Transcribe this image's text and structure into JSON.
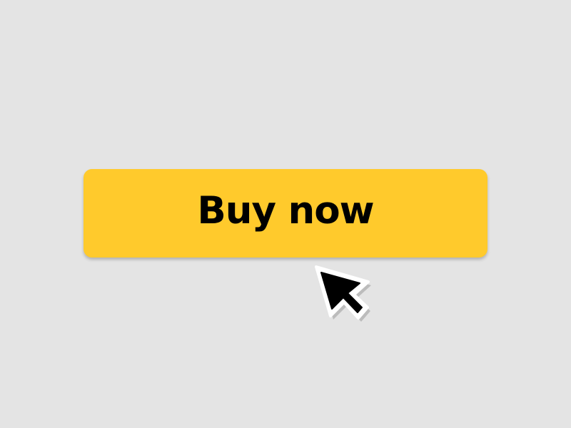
{
  "button": {
    "label": "Buy now",
    "background_color": "#ffca2c",
    "text_color": "#000000"
  },
  "page": {
    "background_color": "#e4e4e4"
  },
  "cursor": {
    "icon": "arrow-pointer-icon"
  }
}
